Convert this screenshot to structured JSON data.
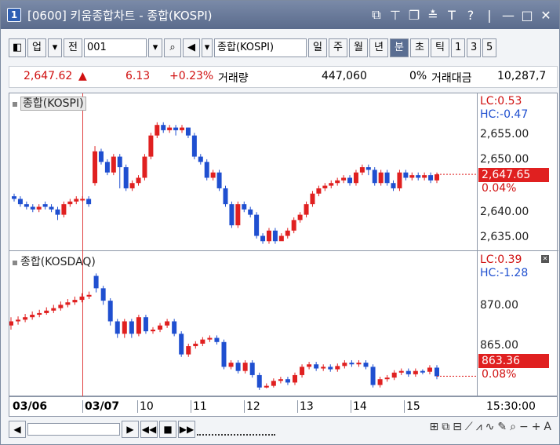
{
  "window": {
    "number": "1",
    "title": "[0600] 키움종합차트 - 종합(KOSPI)",
    "icons": [
      "restore-icon",
      "pin-icon",
      "tile-icon",
      "marker-icon",
      "font-icon",
      "help-icon",
      "minimize-icon",
      "maximize-icon",
      "close-icon"
    ]
  },
  "toolbar": {
    "type_label": "업",
    "market_label": "전",
    "code": "001",
    "name": "종합(KOSPI)",
    "periods": [
      "일",
      "주",
      "월",
      "년",
      "분",
      "초",
      "틱",
      "1",
      "3",
      "5"
    ],
    "active_period": "분"
  },
  "quote": {
    "price": "2,647.62",
    "arrow": "▲",
    "change": "6.13",
    "change_pct": "+0.23%",
    "volume_label": "거래량",
    "volume": "447,060",
    "zero_pct": "0%",
    "amount_label": "거래대금",
    "amount": "10,287,7"
  },
  "panels": {
    "top": {
      "label": "종합(KOSPI)",
      "lc": "LC:0.53",
      "hc": "HC:-0.47",
      "price_box": "2,647.65",
      "pct": "0.04%",
      "y_ticks": [
        "2,655.00",
        "2,650.00",
        "2,640.00",
        "2,635.00"
      ]
    },
    "bottom": {
      "label": "종합(KOSDAQ)",
      "lc": "LC:0.39",
      "hc": "HC:-1.28",
      "price_box": "863.36",
      "pct": "0.08%",
      "y_ticks": [
        "870.00",
        "865.00"
      ]
    }
  },
  "date_axis": [
    "03/06",
    "03/07",
    "10",
    "11",
    "12",
    "13",
    "14",
    "15"
  ],
  "time_label": "15:30:00",
  "colors": {
    "up": "#e02020",
    "down": "#1f4fd0",
    "accent": "#5a6e92"
  },
  "chart_data": [
    {
      "type": "candlestick",
      "name": "종합(KOSPI)",
      "ylim": [
        2634,
        2660
      ],
      "candles": [
        [
          2643.5,
          2643,
          2644,
          2642.5
        ],
        [
          2643,
          2642,
          2643.5,
          2641.5
        ],
        [
          2642,
          2641.5,
          2642.5,
          2641
        ],
        [
          2641.5,
          2641,
          2642,
          2640.5
        ],
        [
          2641,
          2641.5,
          2642,
          2640.5
        ],
        [
          2642,
          2641.5,
          2642.5,
          2641
        ],
        [
          2641.5,
          2641,
          2642,
          2640.5
        ],
        [
          2641,
          2640,
          2641.5,
          2639
        ],
        [
          2640,
          2642,
          2642.5,
          2639.5
        ],
        [
          2642,
          2642.5,
          2643,
          2641.5
        ],
        [
          2642.5,
          2643,
          2643.5,
          2642
        ],
        [
          2643,
          2643,
          2643.5,
          2642.5
        ],
        [
          2643,
          2642,
          2643.5,
          2641.5
        ],
        [
          2646,
          2652,
          2653,
          2645.5
        ],
        [
          2652,
          2650,
          2652.5,
          2649.5
        ],
        [
          2650,
          2648,
          2650.5,
          2647.5
        ],
        [
          2648,
          2651,
          2651.5,
          2647.5
        ],
        [
          2651,
          2649,
          2651.5,
          2645
        ],
        [
          2649,
          2645,
          2649.5,
          2644.5
        ],
        [
          2645,
          2646,
          2646.5,
          2644.5
        ],
        [
          2646,
          2647,
          2647.5,
          2645.5
        ],
        [
          2647,
          2651,
          2651.5,
          2646.5
        ],
        [
          2651,
          2655,
          2655.5,
          2650.5
        ],
        [
          2655,
          2657,
          2657.5,
          2654.5
        ],
        [
          2657,
          2656,
          2657.5,
          2655.5
        ],
        [
          2656,
          2656.5,
          2657,
          2655.5
        ],
        [
          2656.5,
          2656,
          2657,
          2655
        ],
        [
          2656,
          2656.5,
          2657,
          2655.5
        ],
        [
          2656.5,
          2655,
          2656.5,
          2654.5
        ],
        [
          2655,
          2651,
          2655.5,
          2650.5
        ],
        [
          2651,
          2650,
          2651.5,
          2649.5
        ],
        [
          2650,
          2647,
          2650.5,
          2646.5
        ],
        [
          2647,
          2648,
          2648.5,
          2646.5
        ],
        [
          2648,
          2645,
          2648.5,
          2644.5
        ],
        [
          2645,
          2642,
          2645.5,
          2641.5
        ],
        [
          2642,
          2638,
          2642.5,
          2637.5
        ],
        [
          2638,
          2642,
          2642.5,
          2637.5
        ],
        [
          2642,
          2641,
          2642.5,
          2640.5
        ],
        [
          2641,
          2640,
          2641.5,
          2639.5
        ],
        [
          2640,
          2636,
          2640.5,
          2635.5
        ],
        [
          2636,
          2635,
          2636.5,
          2634.5
        ],
        [
          2635,
          2637,
          2637.5,
          2634.5
        ],
        [
          2637,
          2635,
          2637.5,
          2634.5
        ],
        [
          2635,
          2636,
          2636.5,
          2635.5
        ],
        [
          2636,
          2637,
          2637.5,
          2635.5
        ],
        [
          2637,
          2639,
          2639.5,
          2636.5
        ],
        [
          2639,
          2640,
          2640.5,
          2638.5
        ],
        [
          2640,
          2642,
          2642.5,
          2639.5
        ],
        [
          2642,
          2644,
          2644.5,
          2641.5
        ],
        [
          2644,
          2645,
          2645.5,
          2643.5
        ],
        [
          2645,
          2645.5,
          2646,
          2644.5
        ],
        [
          2645.5,
          2646,
          2646.5,
          2645
        ],
        [
          2646,
          2646.5,
          2647,
          2645.5
        ],
        [
          2646.5,
          2647,
          2647.5,
          2646
        ],
        [
          2647,
          2646,
          2647.5,
          2645.5
        ],
        [
          2646,
          2648,
          2648.5,
          2645.5
        ],
        [
          2648,
          2649,
          2649.5,
          2647.5
        ],
        [
          2649,
          2648.5,
          2649.5,
          2647.5
        ],
        [
          2648.5,
          2646,
          2649,
          2645.5
        ],
        [
          2646,
          2648,
          2648.5,
          2645.5
        ],
        [
          2648,
          2646,
          2648.5,
          2645.5
        ],
        [
          2646,
          2645,
          2646.5,
          2644.5
        ],
        [
          2645,
          2648,
          2648.5,
          2644.5
        ],
        [
          2648,
          2647,
          2648.5,
          2646.5
        ],
        [
          2647,
          2647.5,
          2648,
          2646.5
        ],
        [
          2647.5,
          2647,
          2648,
          2646.5
        ],
        [
          2647,
          2647.5,
          2648,
          2646.5
        ],
        [
          2647.5,
          2646.5,
          2648,
          2646
        ],
        [
          2646.5,
          2647.65,
          2648,
          2646
        ]
      ]
    },
    {
      "type": "candlestick",
      "name": "종합(KOSDAQ)",
      "ylim": [
        861.5,
        876.5
      ],
      "candles": [
        [
          869.5,
          870,
          870.5,
          869
        ],
        [
          870,
          870.2,
          870.6,
          869.6
        ],
        [
          870.2,
          870.5,
          870.9,
          869.9
        ],
        [
          870.5,
          870.8,
          871.2,
          870.2
        ],
        [
          870.8,
          871,
          871.4,
          870.5
        ],
        [
          871,
          871.3,
          871.7,
          870.8
        ],
        [
          871.3,
          871.6,
          872,
          871
        ],
        [
          871.6,
          872,
          872.4,
          871.3
        ],
        [
          872,
          872.3,
          872.7,
          871.7
        ],
        [
          872.3,
          872.6,
          873,
          872
        ],
        [
          872.6,
          873,
          873.4,
          872.3
        ],
        [
          873,
          873.2,
          873.6,
          872.7
        ],
        [
          875.5,
          874,
          875.8,
          873.5
        ],
        [
          874,
          872.5,
          874.3,
          872
        ],
        [
          872.5,
          870,
          872.8,
          869.5
        ],
        [
          870,
          868.5,
          870.3,
          868
        ],
        [
          868.5,
          870,
          870.3,
          868
        ],
        [
          870,
          868.5,
          870.3,
          868
        ],
        [
          868.5,
          870.5,
          870.8,
          868.2
        ],
        [
          870.5,
          868.8,
          870.8,
          868.5
        ],
        [
          868.8,
          869,
          869.3,
          868.5
        ],
        [
          869,
          869.5,
          869.8,
          868.7
        ],
        [
          869.5,
          870,
          870.3,
          869.2
        ],
        [
          870,
          868.5,
          870.3,
          868.2
        ],
        [
          868.5,
          866,
          868.8,
          865.7
        ],
        [
          866,
          867,
          867.3,
          865.7
        ],
        [
          867,
          867.3,
          867.6,
          866.7
        ],
        [
          867.3,
          867.8,
          868.1,
          867
        ],
        [
          867.8,
          868,
          868.3,
          867.5
        ],
        [
          868,
          867.5,
          868.3,
          867.2
        ],
        [
          867.5,
          864.5,
          867.8,
          864.2
        ],
        [
          864.5,
          865,
          865.3,
          864.2
        ],
        [
          865,
          864,
          865.3,
          863.7
        ],
        [
          864,
          865,
          865.3,
          863.7
        ],
        [
          865,
          863.5,
          865.3,
          863.2
        ],
        [
          863.5,
          862,
          863.8,
          861.7
        ],
        [
          862,
          862.2,
          862.5,
          861.9
        ],
        [
          862.2,
          862.8,
          863.1,
          862
        ],
        [
          862.8,
          863,
          863.3,
          862.5
        ],
        [
          863,
          862.6,
          863.3,
          862.3
        ],
        [
          862.6,
          863.5,
          863.8,
          862.3
        ],
        [
          863.5,
          864.5,
          864.8,
          863.2
        ],
        [
          864.5,
          864.8,
          865.1,
          864.2
        ],
        [
          864.8,
          864.3,
          865.1,
          864
        ],
        [
          864.3,
          864.5,
          864.8,
          864
        ],
        [
          864.5,
          864.2,
          864.8,
          863.9
        ],
        [
          864.2,
          864.6,
          864.9,
          863.9
        ],
        [
          864.6,
          865,
          865.3,
          864.3
        ],
        [
          865,
          864.8,
          865.3,
          864.5
        ],
        [
          864.8,
          865,
          865.3,
          864.5
        ],
        [
          865,
          864.5,
          865.3,
          864.2
        ],
        [
          864.5,
          862.3,
          864.8,
          862
        ],
        [
          862.3,
          863,
          863.3,
          862
        ],
        [
          863,
          863.2,
          863.5,
          862.7
        ],
        [
          863.2,
          863.8,
          864.1,
          862.9
        ],
        [
          863.8,
          864,
          864.3,
          863.5
        ],
        [
          864,
          863.6,
          864.3,
          863.3
        ],
        [
          863.6,
          864,
          864.3,
          863.3
        ],
        [
          864,
          863.9,
          864.2,
          863.6
        ],
        [
          863.9,
          864.4,
          864.7,
          863.6
        ],
        [
          864.4,
          863.36,
          864.7,
          863
        ]
      ]
    }
  ]
}
